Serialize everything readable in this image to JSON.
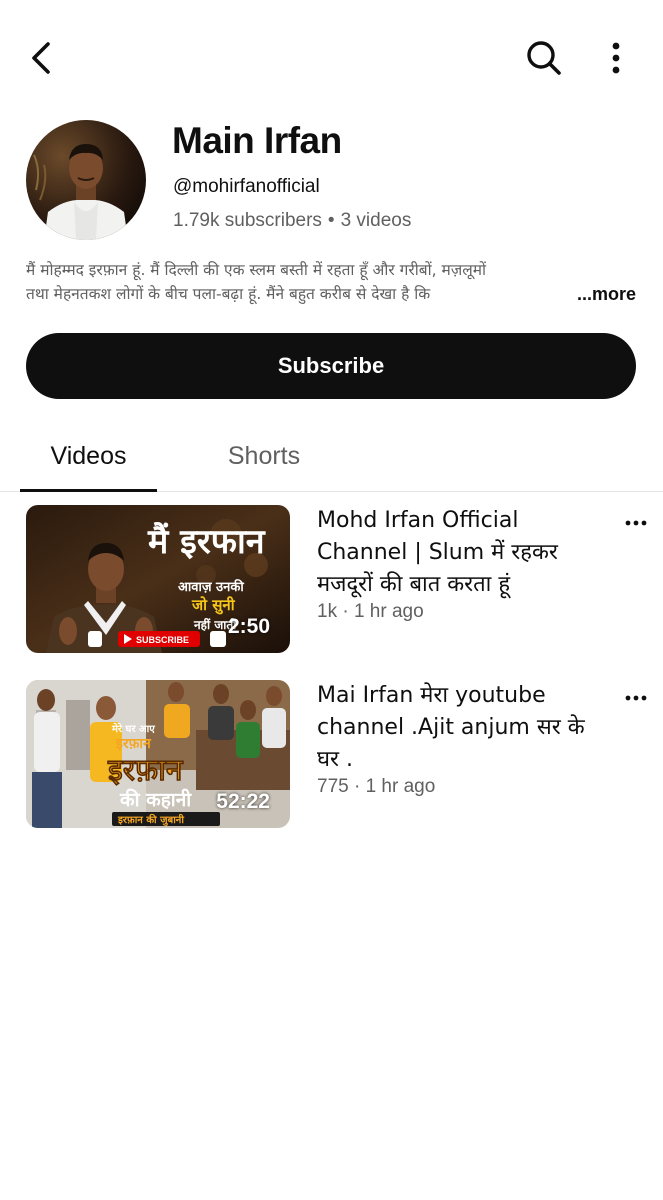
{
  "header": {
    "back_icon": "chevron-left-icon",
    "search_icon": "search-icon",
    "more_icon": "more-vertical-icon"
  },
  "channel": {
    "name": "Main Irfan",
    "handle": "@mohirfanofficial",
    "subscribers": "1.79k subscribers",
    "separator": "•",
    "videos_count": "3 videos",
    "description_line1": "मैं मोहम्मद इरफ़ान हूं. मैं दिल्ली की एक स्लम बस्ती में रहता हूँ और गरीबों, मज़लूमों",
    "description_line2": "तथा मेहनतकश लोगों के बीच पला-बढ़ा हूं. मैंने बहुत करीब से देखा है कि",
    "more_label": "...more"
  },
  "subscribe": {
    "label": "Subscribe"
  },
  "tabs": [
    {
      "label": "Videos",
      "selected": true
    },
    {
      "label": "Shorts",
      "selected": false
    }
  ],
  "videos": [
    {
      "title": "Mohd Irfan Official Channel | Slum में रहकर मजदूरों की बात करता हूं",
      "meta": "1k · 1 hr ago",
      "duration": "2:50",
      "thumb_text": {
        "headline": "मैं इरफान",
        "sub1": "आवाज़ उनकी",
        "sub2": "जो सुनी",
        "sub3": "नहीं जाती",
        "subscribe": "SUBSCRIBE"
      }
    },
    {
      "title": "Mai Irfan मेरा youtube channel .Ajit anjum सर के घर .",
      "meta": "775 · 1 hr ago",
      "duration": "52:22",
      "thumb_text": {
        "top": "मेरे घर आए",
        "name_small": "इरफ़ान",
        "headline": "इरफ़ान",
        "sub1": "की कहानी",
        "sub2": "इरफ़ान की जुबानी"
      }
    }
  ],
  "colors": {
    "text_primary": "#0f0f0f",
    "text_secondary": "#606060",
    "button_bg": "#0f0f0f",
    "accent_orange": "#f5a623",
    "youtube_red": "#ff0000"
  }
}
